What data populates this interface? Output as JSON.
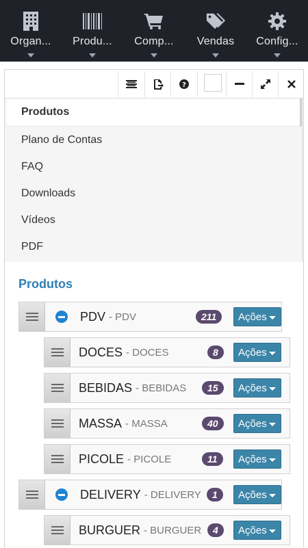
{
  "nav": {
    "items": [
      {
        "label": "Organ...",
        "icon": "building-icon"
      },
      {
        "label": "Produ...",
        "icon": "barcode-icon"
      },
      {
        "label": "Comp...",
        "icon": "cart-icon"
      },
      {
        "label": "Vendas",
        "icon": "tags-icon"
      },
      {
        "label": "Config...",
        "icon": "gear-icon"
      }
    ]
  },
  "toolbar": {
    "icons": [
      "list-icon",
      "export-icon",
      "help-icon",
      "color-swatch",
      "minimize-icon",
      "expand-icon",
      "close-icon"
    ]
  },
  "menu": {
    "items": [
      {
        "label": "Produtos",
        "active": true
      },
      {
        "label": "Plano de Contas"
      },
      {
        "label": "FAQ"
      },
      {
        "label": "Downloads"
      },
      {
        "label": "Vídeos"
      },
      {
        "label": "PDF"
      }
    ]
  },
  "content": {
    "title": "Produtos",
    "action_label": "Ações",
    "rows": [
      {
        "name": "PDV",
        "sub": "- PDV",
        "count": "211",
        "level": 0,
        "expanded": true
      },
      {
        "name": "DOCES",
        "sub": "- DOCES",
        "count": "8",
        "level": 1
      },
      {
        "name": "BEBIDAS",
        "sub": "- BEBIDAS",
        "count": "15",
        "level": 1
      },
      {
        "name": "MASSA",
        "sub": "- MASSA",
        "count": "40",
        "level": 1
      },
      {
        "name": "PICOLE",
        "sub": "- PICOLE",
        "count": "11",
        "level": 1
      },
      {
        "name": "DELIVERY",
        "sub": "- DELIVERY",
        "count": "1",
        "level": 0,
        "expanded": true
      },
      {
        "name": "BURGUER",
        "sub": "- BURGUER",
        "count": "4",
        "level": 1
      }
    ]
  },
  "colors": {
    "nav_bg": "#1f2329",
    "accent": "#2f7fb4",
    "badge": "#5b4a6e",
    "button": "#3b85a8"
  }
}
